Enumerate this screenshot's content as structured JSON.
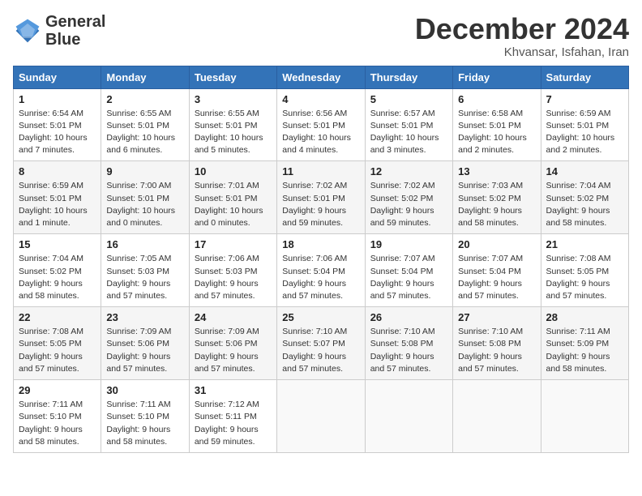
{
  "header": {
    "logo_line1": "General",
    "logo_line2": "Blue",
    "month": "December 2024",
    "location": "Khvansar, Isfahan, Iran"
  },
  "weekdays": [
    "Sunday",
    "Monday",
    "Tuesday",
    "Wednesday",
    "Thursday",
    "Friday",
    "Saturday"
  ],
  "weeks": [
    [
      {
        "day": "1",
        "sunrise": "6:54 AM",
        "sunset": "5:01 PM",
        "daylight": "10 hours and 7 minutes."
      },
      {
        "day": "2",
        "sunrise": "6:55 AM",
        "sunset": "5:01 PM",
        "daylight": "10 hours and 6 minutes."
      },
      {
        "day": "3",
        "sunrise": "6:55 AM",
        "sunset": "5:01 PM",
        "daylight": "10 hours and 5 minutes."
      },
      {
        "day": "4",
        "sunrise": "6:56 AM",
        "sunset": "5:01 PM",
        "daylight": "10 hours and 4 minutes."
      },
      {
        "day": "5",
        "sunrise": "6:57 AM",
        "sunset": "5:01 PM",
        "daylight": "10 hours and 3 minutes."
      },
      {
        "day": "6",
        "sunrise": "6:58 AM",
        "sunset": "5:01 PM",
        "daylight": "10 hours and 2 minutes."
      },
      {
        "day": "7",
        "sunrise": "6:59 AM",
        "sunset": "5:01 PM",
        "daylight": "10 hours and 2 minutes."
      }
    ],
    [
      {
        "day": "8",
        "sunrise": "6:59 AM",
        "sunset": "5:01 PM",
        "daylight": "10 hours and 1 minute."
      },
      {
        "day": "9",
        "sunrise": "7:00 AM",
        "sunset": "5:01 PM",
        "daylight": "10 hours and 0 minutes."
      },
      {
        "day": "10",
        "sunrise": "7:01 AM",
        "sunset": "5:01 PM",
        "daylight": "10 hours and 0 minutes."
      },
      {
        "day": "11",
        "sunrise": "7:02 AM",
        "sunset": "5:01 PM",
        "daylight": "9 hours and 59 minutes."
      },
      {
        "day": "12",
        "sunrise": "7:02 AM",
        "sunset": "5:02 PM",
        "daylight": "9 hours and 59 minutes."
      },
      {
        "day": "13",
        "sunrise": "7:03 AM",
        "sunset": "5:02 PM",
        "daylight": "9 hours and 58 minutes."
      },
      {
        "day": "14",
        "sunrise": "7:04 AM",
        "sunset": "5:02 PM",
        "daylight": "9 hours and 58 minutes."
      }
    ],
    [
      {
        "day": "15",
        "sunrise": "7:04 AM",
        "sunset": "5:02 PM",
        "daylight": "9 hours and 58 minutes."
      },
      {
        "day": "16",
        "sunrise": "7:05 AM",
        "sunset": "5:03 PM",
        "daylight": "9 hours and 57 minutes."
      },
      {
        "day": "17",
        "sunrise": "7:06 AM",
        "sunset": "5:03 PM",
        "daylight": "9 hours and 57 minutes."
      },
      {
        "day": "18",
        "sunrise": "7:06 AM",
        "sunset": "5:04 PM",
        "daylight": "9 hours and 57 minutes."
      },
      {
        "day": "19",
        "sunrise": "7:07 AM",
        "sunset": "5:04 PM",
        "daylight": "9 hours and 57 minutes."
      },
      {
        "day": "20",
        "sunrise": "7:07 AM",
        "sunset": "5:04 PM",
        "daylight": "9 hours and 57 minutes."
      },
      {
        "day": "21",
        "sunrise": "7:08 AM",
        "sunset": "5:05 PM",
        "daylight": "9 hours and 57 minutes."
      }
    ],
    [
      {
        "day": "22",
        "sunrise": "7:08 AM",
        "sunset": "5:05 PM",
        "daylight": "9 hours and 57 minutes."
      },
      {
        "day": "23",
        "sunrise": "7:09 AM",
        "sunset": "5:06 PM",
        "daylight": "9 hours and 57 minutes."
      },
      {
        "day": "24",
        "sunrise": "7:09 AM",
        "sunset": "5:06 PM",
        "daylight": "9 hours and 57 minutes."
      },
      {
        "day": "25",
        "sunrise": "7:10 AM",
        "sunset": "5:07 PM",
        "daylight": "9 hours and 57 minutes."
      },
      {
        "day": "26",
        "sunrise": "7:10 AM",
        "sunset": "5:08 PM",
        "daylight": "9 hours and 57 minutes."
      },
      {
        "day": "27",
        "sunrise": "7:10 AM",
        "sunset": "5:08 PM",
        "daylight": "9 hours and 57 minutes."
      },
      {
        "day": "28",
        "sunrise": "7:11 AM",
        "sunset": "5:09 PM",
        "daylight": "9 hours and 58 minutes."
      }
    ],
    [
      {
        "day": "29",
        "sunrise": "7:11 AM",
        "sunset": "5:10 PM",
        "daylight": "9 hours and 58 minutes."
      },
      {
        "day": "30",
        "sunrise": "7:11 AM",
        "sunset": "5:10 PM",
        "daylight": "9 hours and 58 minutes."
      },
      {
        "day": "31",
        "sunrise": "7:12 AM",
        "sunset": "5:11 PM",
        "daylight": "9 hours and 59 minutes."
      },
      null,
      null,
      null,
      null
    ]
  ]
}
